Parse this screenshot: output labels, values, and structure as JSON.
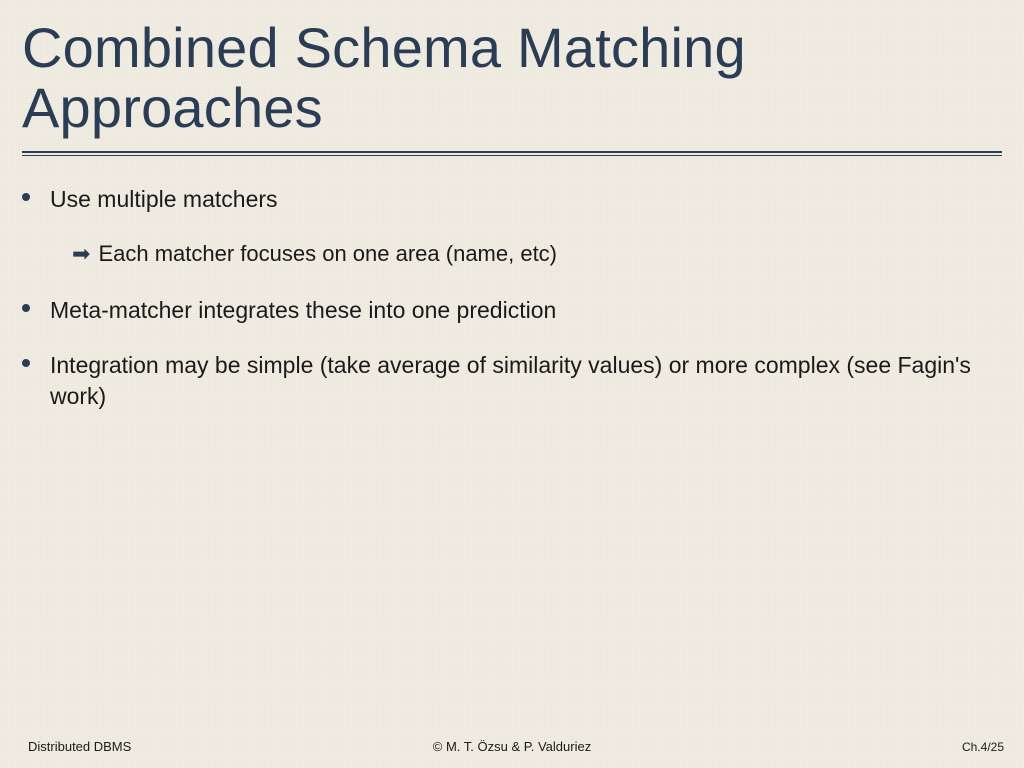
{
  "title": "Combined Schema Matching Approaches",
  "bullets": [
    {
      "text": "Use multiple matchers",
      "subs": [
        "Each matcher focuses on one area (name, etc)"
      ]
    },
    {
      "text": "Meta-matcher integrates these into one prediction",
      "subs": []
    },
    {
      "text": "Integration may be simple (take average of similarity values) or more complex (see Fagin's work)",
      "subs": []
    }
  ],
  "footer": {
    "left": "Distributed DBMS",
    "center": "© M. T. Özsu & P. Valduriez",
    "right": "Ch.4/25"
  }
}
